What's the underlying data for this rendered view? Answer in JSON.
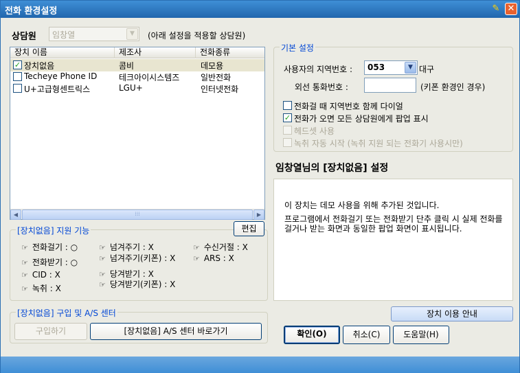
{
  "window": {
    "title": "전화 환경설정"
  },
  "agent": {
    "label": "상담원",
    "selected": "임창열",
    "note": "(아래 설정을 적용할 상담원)"
  },
  "devices": {
    "columns": [
      "장치 이름",
      "제조사",
      "전화종류"
    ],
    "rows": [
      {
        "name": "장치없음",
        "maker": "콤비",
        "type": "데모용",
        "checked": true
      },
      {
        "name": "Techeye Phone ID",
        "maker": "테크아이시스템즈",
        "type": "일반전화",
        "checked": false
      },
      {
        "name": "U+고급형센트릭스",
        "maker": "LGU+",
        "type": "인터넷전화",
        "checked": false
      }
    ]
  },
  "features": {
    "title": "[장치없음] 지원 기능",
    "edit_label": "편집",
    "items": [
      "전화걸기 : ○",
      "전화받기 : ○",
      "CID : X",
      "녹취 : X",
      "넘겨주기 : X",
      "넘겨주기(키폰) : X",
      "당겨받기 : X",
      "당겨받기(키폰) : X",
      "수신거절 : X",
      "ARS : X"
    ]
  },
  "purchase": {
    "title": "[장치없음] 구입 및 A/S 센터",
    "buy_label": "구입하기",
    "as_label": "[장치없음] A/S 센터 바로가기"
  },
  "basic": {
    "title": "기본 설정",
    "area_label": "사용자의 지역번호 :",
    "area_value": "053",
    "area_city": "대구",
    "outline_label": "외선 통화번호 :",
    "outline_value": "",
    "outline_note": "(키폰 환경인 경우)",
    "options": [
      {
        "label": "전화걸 때 지역번호 함께 다이얼",
        "checked": false,
        "enabled": true
      },
      {
        "label": "전화가 오면 모든 상담원에게 팝업 표시",
        "checked": true,
        "enabled": true
      },
      {
        "label": "헤드셋 사용",
        "checked": false,
        "enabled": false
      },
      {
        "label": "녹취 자동 시작 (녹취 지원 되는 전화기 사용시만)",
        "checked": false,
        "enabled": false
      }
    ]
  },
  "device_info": {
    "heading": "임창열님의 [장치없음] 설정",
    "line1": "이 장치는 데모 사용을 위해 추가된 것입니다.",
    "line2": "프로그램에서 전화걸기 또는 전화받기 단추 클릭 시 실제 전화를 걸거나 받는 화면과 동일한 팝업 화면이 표시됩니다."
  },
  "buttons": {
    "guide": "장치 이용 안내",
    "ok": "확인(O)",
    "cancel": "취소(C)",
    "help": "도움말(H)"
  }
}
